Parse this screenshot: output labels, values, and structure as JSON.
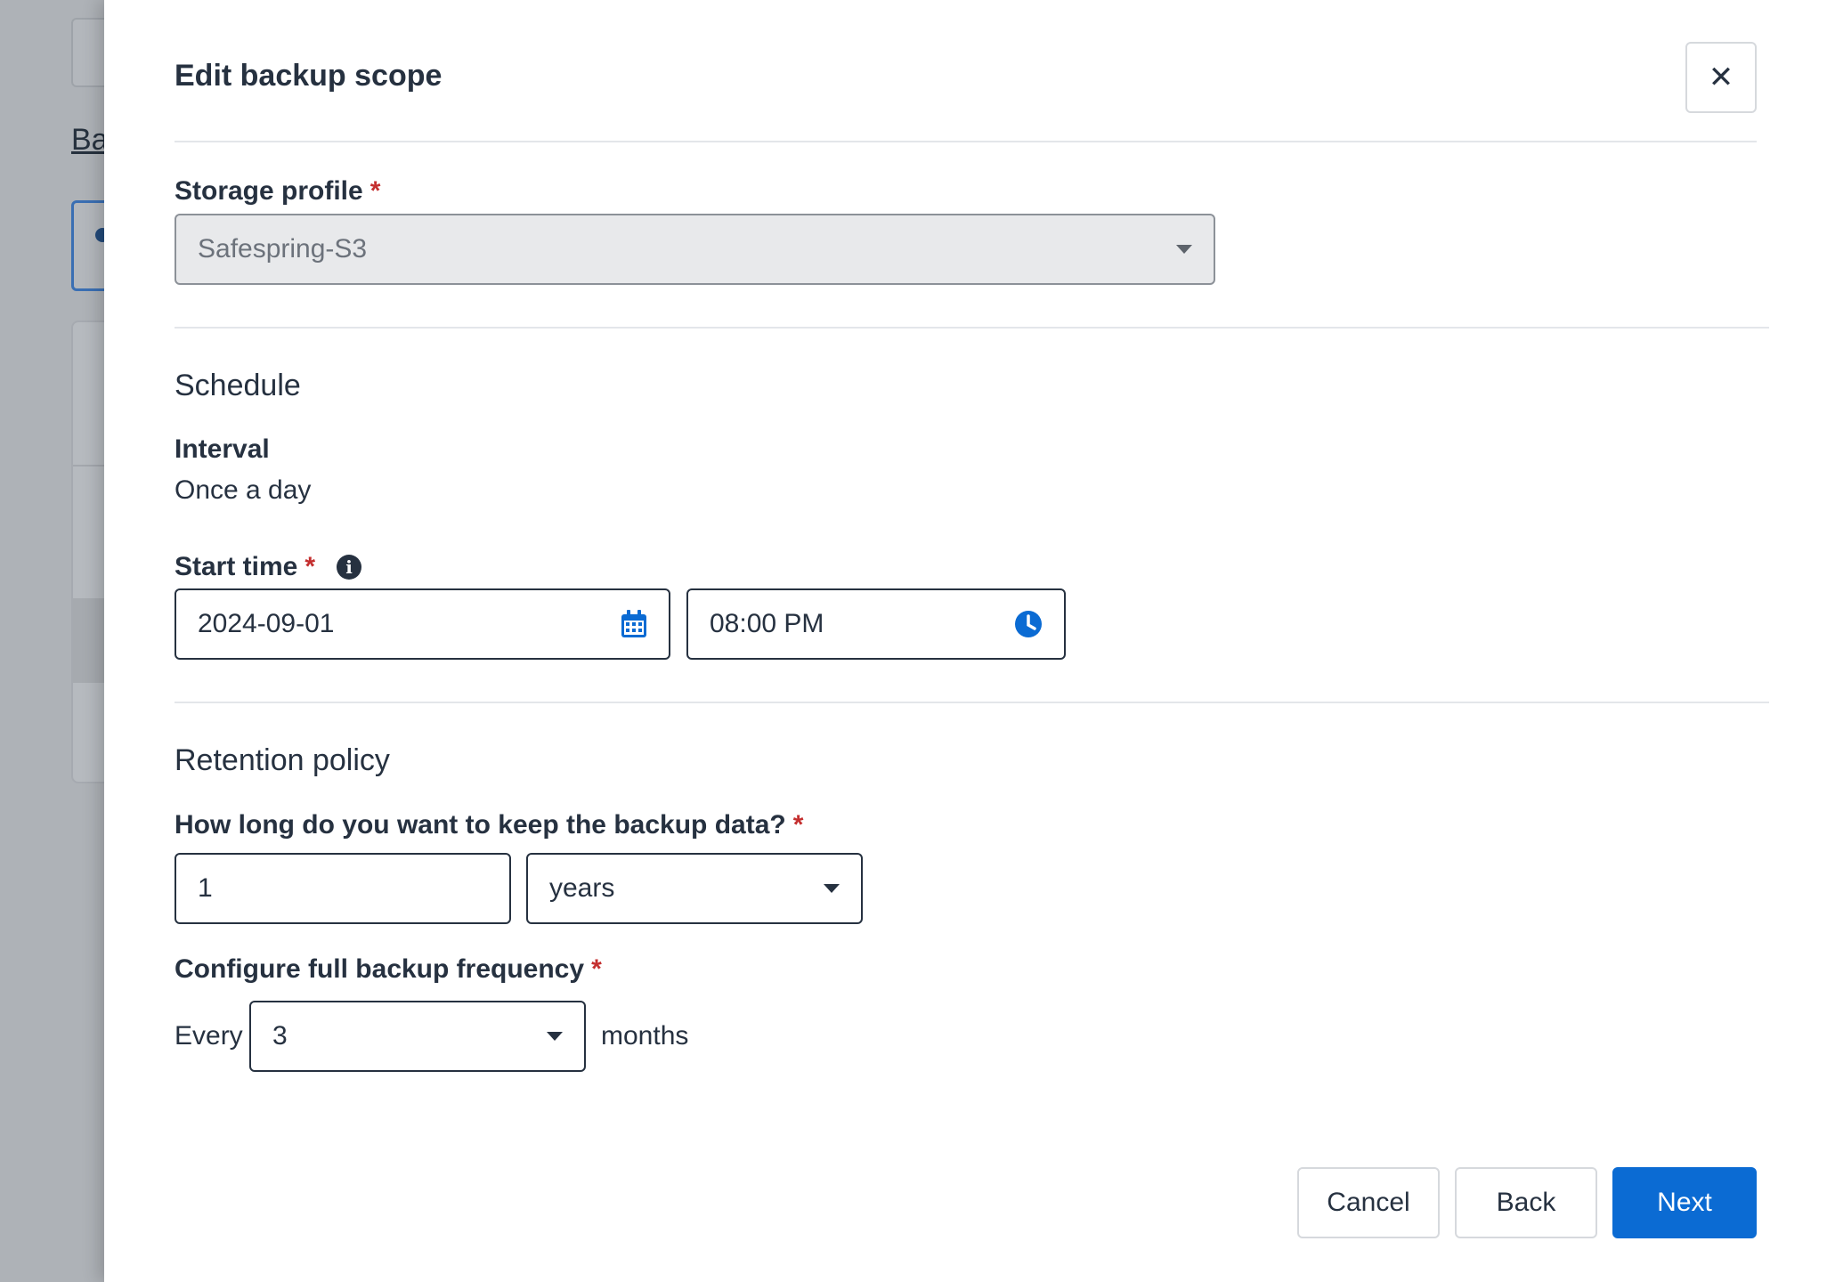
{
  "background": {
    "breadcrumb_fragment": "Ba"
  },
  "dialog": {
    "title": "Edit backup scope",
    "close_icon": "close-icon"
  },
  "storage": {
    "label": "Storage profile",
    "required_mark": "*",
    "value": "Safespring-S3"
  },
  "schedule": {
    "heading": "Schedule",
    "interval_label": "Interval",
    "interval_value": "Once a day",
    "start_time_label": "Start time",
    "required_mark": "*",
    "date_value": "2024-09-01",
    "time_value": "08:00 PM"
  },
  "retention": {
    "heading": "Retention policy",
    "keep_label": "How long do you want to keep the backup data?",
    "required_mark": "*",
    "keep_amount": "1",
    "keep_unit": "years",
    "frequency_label": "Configure full backup frequency",
    "every_label": "Every",
    "frequency_value": "3",
    "months_label": "months"
  },
  "footer": {
    "cancel_label": "Cancel",
    "back_label": "Back",
    "next_label": "Next"
  },
  "colors": {
    "primary": "#0b6bd3",
    "required": "#c42f2f",
    "text": "#263140"
  }
}
